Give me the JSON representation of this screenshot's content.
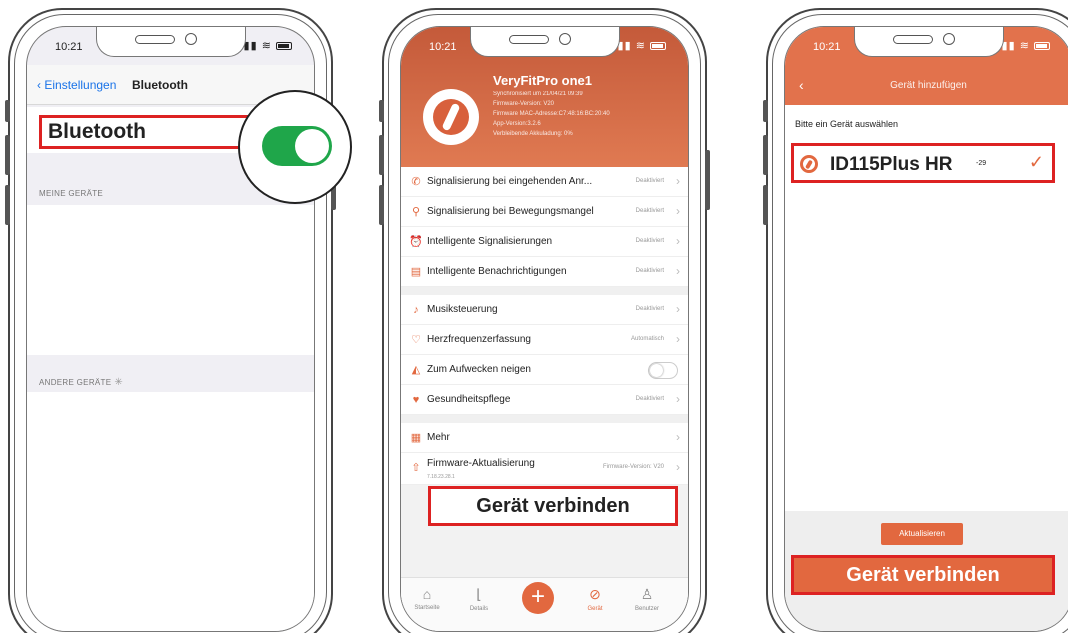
{
  "status": {
    "time": "10:21"
  },
  "phone1": {
    "back_label": "Einstellungen",
    "nav_title": "Bluetooth",
    "bluetooth_label": "Bluetooth",
    "bluetooth_on": true,
    "my_devices_header": "MEINE GERÄTE",
    "other_devices_header": "ANDERE GERÄTE"
  },
  "phone2": {
    "device_name": "VeryFitPro one1",
    "info_lines": [
      "Synchronisiert um 21/04/21 09:39",
      "Firmware-Version: V20",
      "Firmware MAC-Adresse:C7:48:16:BC:20:40",
      "App-Version:3.2.6",
      "Verbleibende Akkuladung: 0%"
    ],
    "menu_group1": [
      {
        "label": "Signalisierung bei eingehenden Anr...",
        "value": "Deaktiviert",
        "icon": "phone-icon"
      },
      {
        "label": "Signalisierung bei Bewegungsmangel",
        "value": "Deaktiviert",
        "icon": "walk-icon"
      },
      {
        "label": "Intelligente Signalisierungen",
        "value": "Deaktiviert",
        "icon": "alarm-icon"
      },
      {
        "label": "Intelligente Benachrichtigungen",
        "value": "Deaktiviert",
        "icon": "message-icon"
      }
    ],
    "menu_group2": [
      {
        "label": "Musiksteuerung",
        "value": "Deaktiviert",
        "icon": "music-icon"
      },
      {
        "label": "Herzfrequenzerfassung",
        "value": "Automatisch",
        "icon": "heart-rate-icon"
      },
      {
        "label": "Zum Aufwecken neigen",
        "value": "",
        "icon": "wrist-icon"
      },
      {
        "label": "Gesundheitspflege",
        "value": "Deaktiviert",
        "icon": "health-icon"
      }
    ],
    "more_label": "Mehr",
    "firmware_label": "Firmware-Aktualisierung",
    "firmware_sub": "7.18.23.28.1",
    "firmware_value": "Firmware-Version: V20",
    "connect_label": "Gerät verbinden",
    "tabs": [
      "Startseite",
      "Details",
      "Gerät",
      "Benutzer"
    ]
  },
  "phone3": {
    "nav_title": "Gerät hinzufügen",
    "pick_label": "Bitte ein Gerät auswählen",
    "device_name": "ID115Plus HR",
    "rssi": "-29",
    "refresh_label": "Aktualisieren",
    "connect_label": "Gerät verbinden"
  },
  "colors": {
    "accent": "#e2683f",
    "highlight": "#dd2222",
    "toggle_on": "#1fa64a"
  }
}
